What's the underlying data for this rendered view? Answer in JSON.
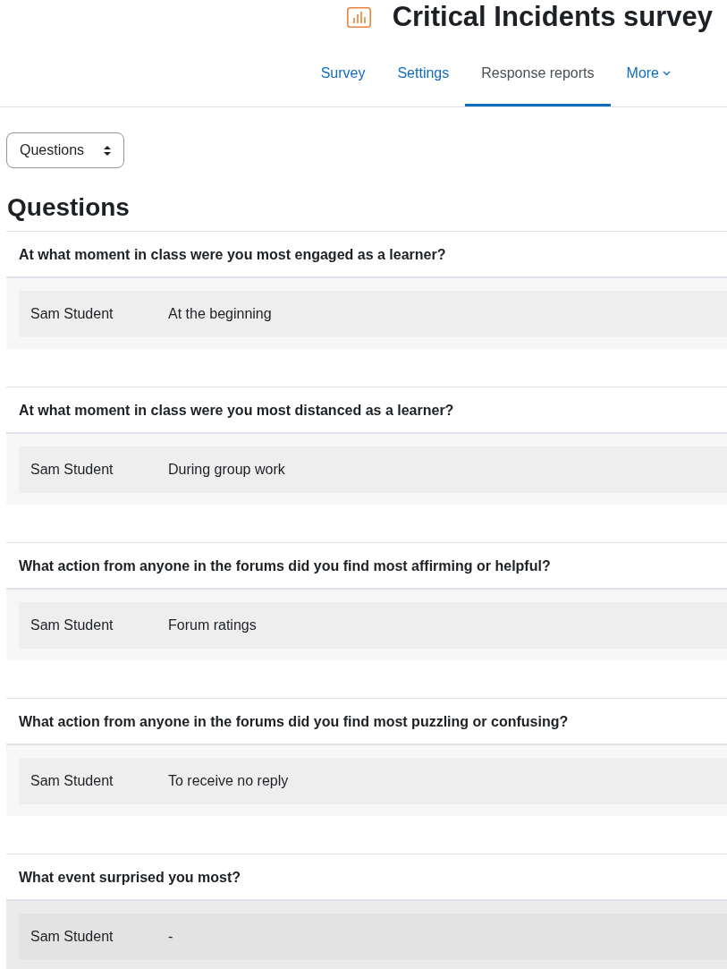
{
  "header": {
    "title": "Critical Incidents survey"
  },
  "tabs": [
    {
      "label": "Survey",
      "selected": false,
      "kind": "link"
    },
    {
      "label": "Settings",
      "selected": false,
      "kind": "link"
    },
    {
      "label": "Response reports",
      "selected": true,
      "kind": "link"
    },
    {
      "label": "More",
      "selected": false,
      "kind": "menu"
    }
  ],
  "report_select": {
    "value": "Questions"
  },
  "heading": "Questions",
  "questions": [
    {
      "text": "At what moment in class were you most engaged as a learner?",
      "highlighted": false,
      "responses": [
        {
          "name": "Sam Student",
          "answer": "At the beginning"
        }
      ]
    },
    {
      "text": "At what moment in class were you most distanced as a learner?",
      "highlighted": false,
      "responses": [
        {
          "name": "Sam Student",
          "answer": "During group work"
        }
      ]
    },
    {
      "text": "What action from anyone in the forums did you find most affirming or helpful?",
      "highlighted": false,
      "responses": [
        {
          "name": "Sam Student",
          "answer": "Forum ratings"
        }
      ]
    },
    {
      "text": "What action from anyone in the forums did you find most puzzling or confusing?",
      "highlighted": false,
      "responses": [
        {
          "name": "Sam Student",
          "answer": "To receive no reply"
        }
      ]
    },
    {
      "text": "What event surprised you most?",
      "highlighted": true,
      "responses": [
        {
          "name": "Sam Student",
          "answer": "-"
        }
      ]
    }
  ]
}
